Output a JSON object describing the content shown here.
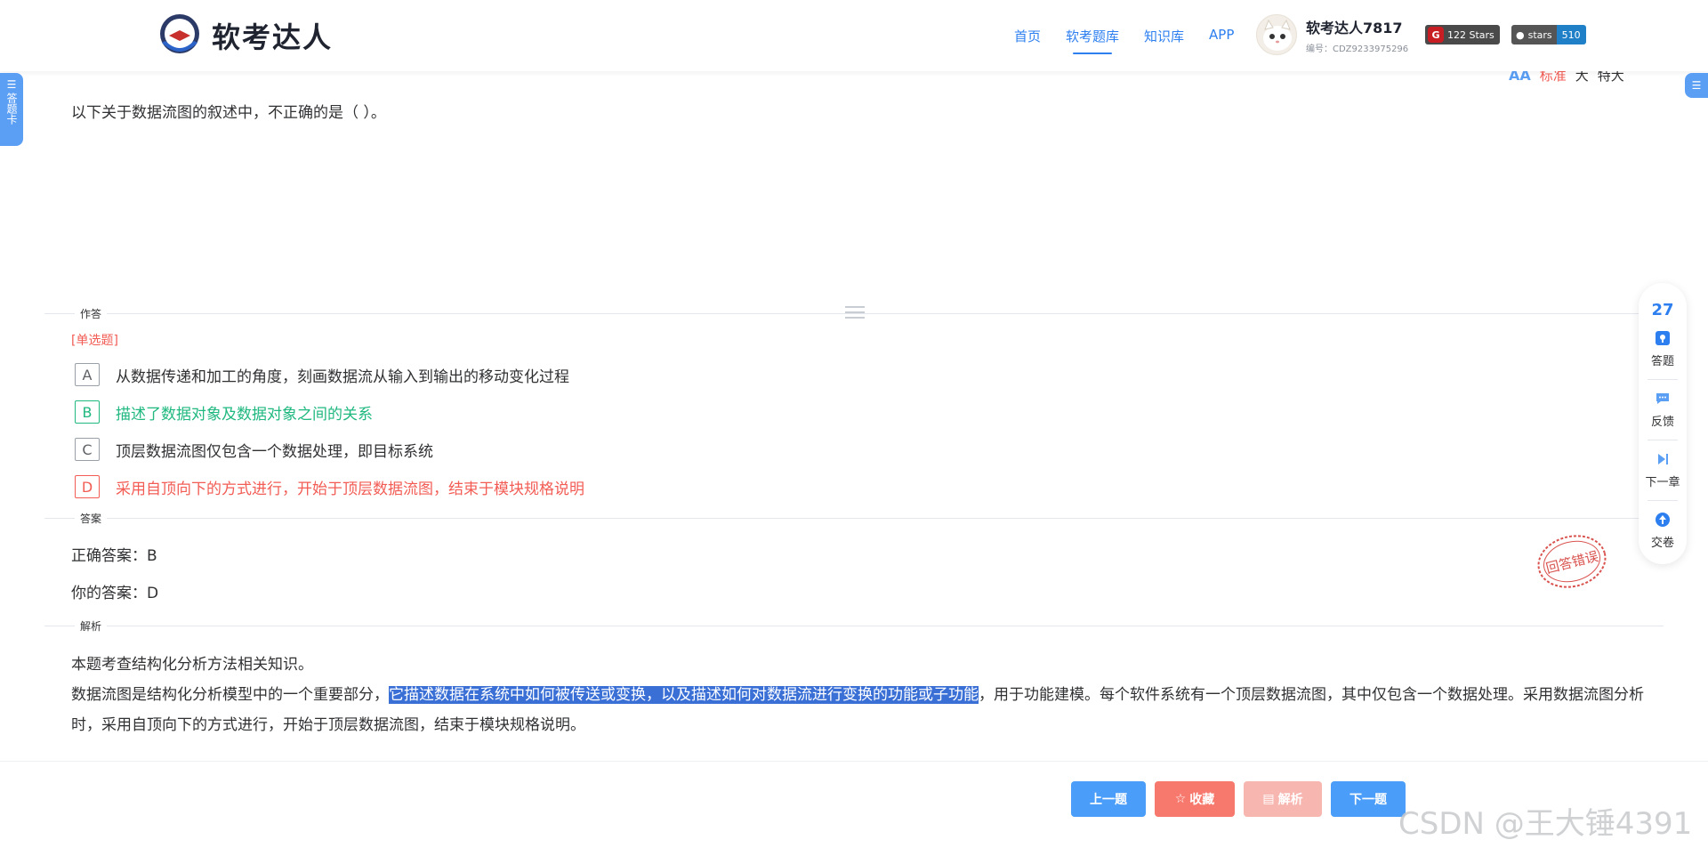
{
  "header": {
    "logo_text": "软考达人",
    "nav": [
      {
        "label": "首页",
        "active": false
      },
      {
        "label": "软考题库",
        "active": true
      },
      {
        "label": "知识库",
        "active": false
      },
      {
        "label": "APP",
        "active": false
      }
    ],
    "user_name": "软考达人7817",
    "user_id": "编号：CDZ9233975296",
    "gitee_badge": "122 Stars",
    "github_badge_label": "stars",
    "github_badge_value": "510"
  },
  "card_tab": {
    "label": "答题卡"
  },
  "font_switch": {
    "icon": "AA",
    "options": [
      "标准",
      "大",
      "特大"
    ],
    "active": "标准"
  },
  "question": {
    "text": "以下关于数据流图的叙述中，不正确的是（ ）。",
    "answer_section_label": "作答",
    "type": "[单选题]",
    "options": [
      {
        "letter": "A",
        "text": "从数据传递和加工的角度，刻画数据流从输入到输出的移动变化过程",
        "state": "normal"
      },
      {
        "letter": "B",
        "text": "描述了数据对象及数据对象之间的关系",
        "state": "correct"
      },
      {
        "letter": "C",
        "text": "顶层数据流图仅包含一个数据处理，即目标系统",
        "state": "normal"
      },
      {
        "letter": "D",
        "text": "采用自顶向下的方式进行，开始于顶层数据流图，结束于模块规格说明",
        "state": "wrong"
      }
    ]
  },
  "answer": {
    "section_label": "答案",
    "correct": "正确答案：B",
    "yours": "你的答案：D",
    "stamp": "回答错误"
  },
  "analysis": {
    "section_label": "解析",
    "line1": "本题考查结构化分析方法相关知识。",
    "line2_before": "数据流图是结构化分析模型中的一个重要部分，",
    "line2_highlight": "它描述数据在系统中如何被传送或变换，以及描述如何对数据流进行变换的功能或子功能",
    "line2_after": "，用于功能建模。每个软件系统有一个顶层数据流图，其中仅包含一个数据处理。采用数据流图分析时，采用自顶向下的方式进行，开始于顶层数据流图，结束于模块规格说明。"
  },
  "float_panel": {
    "count": "27",
    "items": [
      {
        "label": "答题",
        "icon": "answer-icon"
      },
      {
        "label": "反馈",
        "icon": "feedback-icon"
      },
      {
        "label": "下一章",
        "icon": "next-chapter-icon"
      },
      {
        "label": "交卷",
        "icon": "submit-icon"
      }
    ]
  },
  "bottom": {
    "prev": "上一题",
    "fav": "收藏",
    "analysis": "解析",
    "next": "下一题"
  },
  "watermark": "CSDN @王大锤4391",
  "colors": {
    "accent": "#2d7ff0",
    "correct": "#1fb87f",
    "wrong": "#f25c54",
    "highlight": "#3a6fd6"
  }
}
